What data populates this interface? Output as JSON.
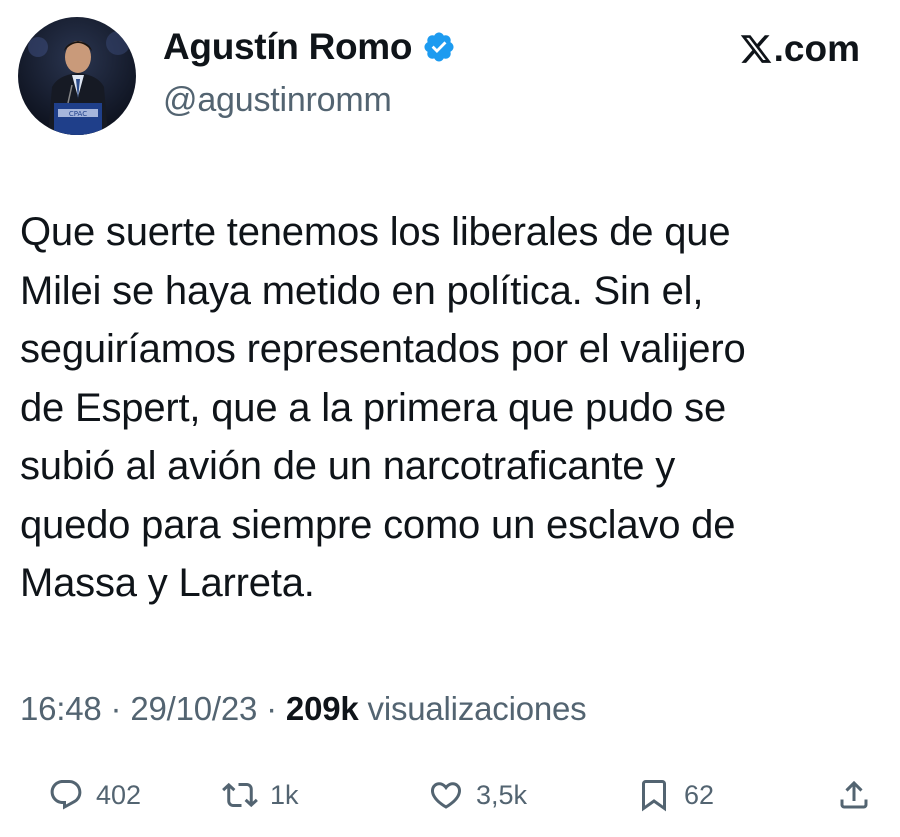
{
  "author": {
    "name": "Agustín Romo",
    "handle": "@agustinromm",
    "verified": true,
    "badge_color": "#1d9bf0"
  },
  "site": {
    "label": ".com",
    "logo_icon": "x-logo-icon"
  },
  "tweet": {
    "lines": [
      "Que suerte tenemos los liberales de que",
      "Milei se haya metido en política. Sin el,",
      "seguiríamos representados por el valijero",
      "de Espert, que a la primera que pudo se",
      "subió al avión de un narcotraficante y",
      "quedo para siempre como un esclavo de",
      "Massa y Larreta."
    ]
  },
  "meta": {
    "time": "16:48",
    "separator": " · ",
    "date": "29/10/23",
    "views_count": "209k",
    "views_label": " visualizaciones"
  },
  "actions": {
    "reply": {
      "icon": "reply-icon",
      "count": "402"
    },
    "retweet": {
      "icon": "retweet-icon",
      "count": "1k"
    },
    "like": {
      "icon": "heart-icon",
      "count": "3,5k"
    },
    "bookmark": {
      "icon": "bookmark-icon",
      "count": "62"
    },
    "share": {
      "icon": "share-icon"
    }
  }
}
